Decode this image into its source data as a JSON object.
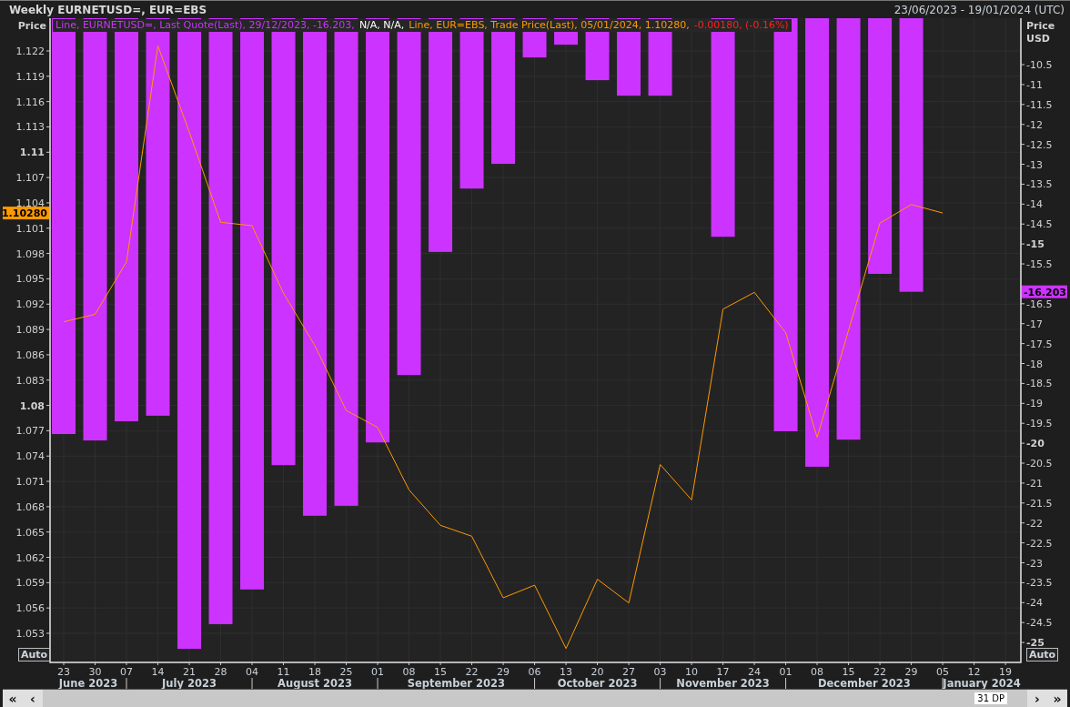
{
  "header": {
    "title": "Weekly EURNETUSD=, EUR=EBS",
    "date_range": "23/06/2023 - 19/01/2024 (UTC)"
  },
  "chart": {
    "left_axis_title": "Price",
    "right_axis_title": [
      "Price",
      "USD"
    ],
    "auto_buttons": [
      "Auto",
      "Auto"
    ],
    "legend": [
      {
        "text": "Line, EURNETUSD=, Last Quote(Last), 29/12/2023, -16.203,",
        "color": "#cc33ff"
      },
      {
        "text": "N/A, N/A,",
        "color": "#ffffff"
      },
      {
        "text": "Line, EUR=EBS, Trade Price(Last), 05/01/2024, 1.10280,",
        "color": "#ff9900"
      },
      {
        "text": "-0.00180, (-0.16%)",
        "color": "#ff2020"
      }
    ],
    "markers": [
      {
        "label": "1.10280",
        "color": "#ff9900"
      },
      {
        "label": "-16.203",
        "color": "#cc33ff"
      }
    ],
    "months": [
      "June 2023",
      "July 2023",
      "August 2023",
      "September 2023",
      "October 2023",
      "November 2023",
      "December 2023",
      "January 2024"
    ],
    "chart_data": {
      "type": "bar",
      "grid": true,
      "categories": [
        "23",
        "30",
        "07",
        "14",
        "21",
        "28",
        "04",
        "11",
        "18",
        "25",
        "01",
        "08",
        "15",
        "22",
        "29",
        "06",
        "13",
        "20",
        "27",
        "03",
        "10",
        "17",
        "24",
        "01",
        "08",
        "15",
        "22",
        "29",
        "05",
        "12",
        "19"
      ],
      "ylim": [
        1.04955,
        1.12588
      ],
      "yticks": [
        1.053,
        1.056,
        1.059,
        1.062,
        1.065,
        1.068,
        1.071,
        1.074,
        1.077,
        1.08,
        1.083,
        1.086,
        1.089,
        1.092,
        1.095,
        1.098,
        1.101,
        1.104,
        1.107,
        1.11,
        1.113,
        1.116,
        1.119,
        1.122
      ],
      "y2lim": [
        -25.5,
        -9.335
      ],
      "y2ticks": [
        -25,
        -24.5,
        -24,
        -23.5,
        -23,
        -22.5,
        -22,
        -21.5,
        -21,
        -20.5,
        -20,
        -19.5,
        -19,
        -18.5,
        -18,
        -17.5,
        -17,
        -16.5,
        -15.5,
        -15,
        -14.5,
        -14,
        -13.5,
        -13,
        -12.5,
        -12,
        -11.5,
        -11,
        -10.5
      ],
      "series": [
        {
          "axis": "y2",
          "color": "#cc33ff",
          "values": [
            -19.77,
            -19.93,
            -19.45,
            -19.31,
            -25.16,
            -24.54,
            -23.67,
            -20.55,
            -21.82,
            -21.57,
            -19.98,
            -18.29,
            -15.2,
            -13.61,
            -12.99,
            -10.32,
            -10.0,
            -10.89,
            -11.28,
            -11.28,
            null,
            -14.82,
            null,
            -19.7,
            -20.59,
            -19.91,
            -15.75,
            -16.2,
            null,
            null,
            null
          ]
        },
        {
          "type": "line",
          "color": "#ff9900",
          "values": [
            1.0899,
            1.0908,
            1.097,
            1.1226,
            1.1124,
            1.1017,
            1.1013,
            1.0933,
            1.0871,
            1.0794,
            1.0774,
            1.07,
            1.0658,
            1.0645,
            1.0572,
            1.0587,
            1.0512,
            1.0594,
            1.0566,
            1.073,
            1.0688,
            1.0914,
            1.0934,
            1.0886,
            1.0762,
            1.0889,
            1.1016,
            1.1038,
            1.1028,
            null,
            null
          ]
        }
      ]
    }
  },
  "scrollbar": {
    "left_buttons": [
      "«",
      "‹"
    ],
    "points": "31 DP",
    "right_buttons": [
      "›",
      "»"
    ]
  }
}
